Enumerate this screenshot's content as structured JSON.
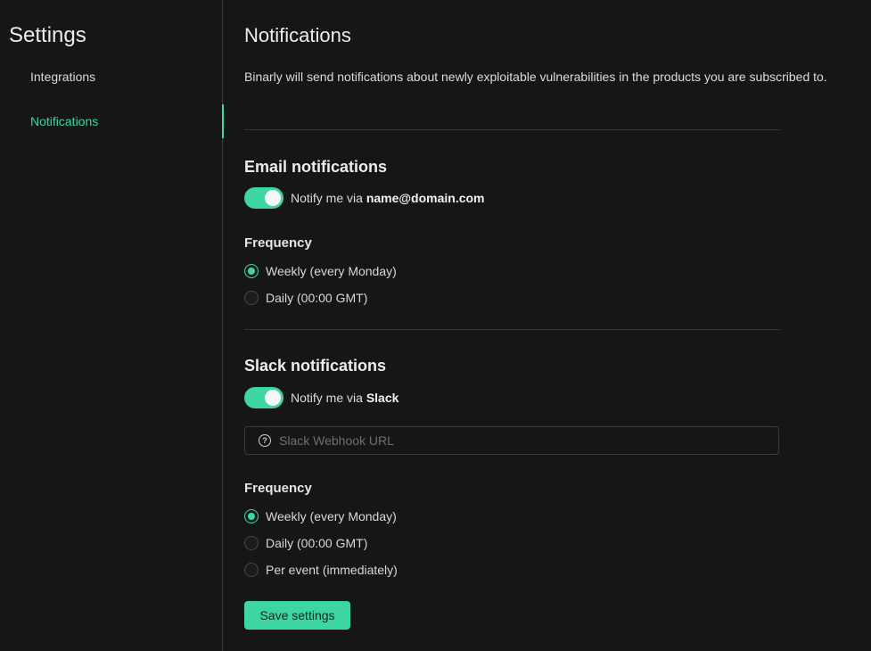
{
  "sidebar": {
    "title": "Settings",
    "items": [
      {
        "label": "Integrations",
        "active": false
      },
      {
        "label": "Notifications",
        "active": true
      }
    ]
  },
  "main": {
    "title": "Notifications",
    "intro": "Binarly will send notifications about newly exploitable vulnerabilities in the products you are subscribed to.",
    "email": {
      "title": "Email notifications",
      "toggle_prefix": "Notify me via",
      "toggle_target": "name@domain.com",
      "enabled": true,
      "frequency_title": "Frequency",
      "options": [
        "Weekly (every Monday)",
        "Daily (00:00 GMT)"
      ],
      "selected": "Weekly (every Monday)"
    },
    "slack": {
      "title": "Slack notifications",
      "toggle_prefix": "Notify me via",
      "toggle_target": "Slack",
      "enabled": true,
      "webhook_placeholder": "Slack Webhook URL",
      "webhook_icon": "question-circle-icon",
      "webhook_icon_glyph": "?",
      "frequency_title": "Frequency",
      "options": [
        "Weekly (every Monday)",
        "Daily (00:00 GMT)",
        "Per event (immediately)"
      ],
      "selected": "Weekly (every Monday)"
    },
    "save_label": "Save settings"
  },
  "colors": {
    "accent": "#3dd6a0",
    "background": "#161616",
    "divider": "#343434"
  }
}
